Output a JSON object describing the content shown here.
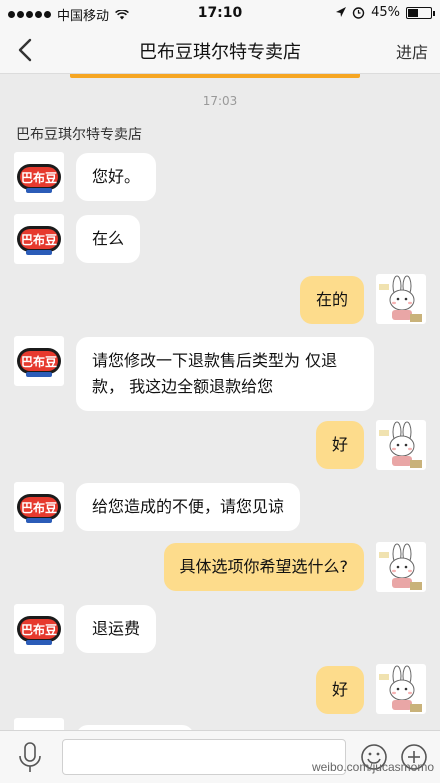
{
  "status_bar": {
    "carrier": "中国移动",
    "time": "17:10",
    "battery": "45%",
    "battery_level": 0.45
  },
  "nav": {
    "title": "巴布豆琪尔特专卖店",
    "enter_label": "进店",
    "back_icon": "chevron-left-icon"
  },
  "chat": {
    "timestamp": "17:03",
    "shop_name": "巴布豆琪尔特专卖店",
    "messages": [
      {
        "from": "shop",
        "text": "您好。"
      },
      {
        "from": "shop",
        "text": "在么"
      },
      {
        "from": "user",
        "text": "在的"
      },
      {
        "from": "shop",
        "text": "请您修改一下退款售后类型为 仅退款， 我这边全额退款给您"
      },
      {
        "from": "user",
        "text": "好"
      },
      {
        "from": "shop",
        "text": "给您造成的不便，请您见谅"
      },
      {
        "from": "user",
        "text": "具体选项你希望选什么?"
      },
      {
        "from": "shop",
        "text": "退运费"
      },
      {
        "from": "user",
        "text": "好"
      }
    ]
  },
  "input_bar": {
    "text": "",
    "mic_icon": "microphone-icon",
    "emoji_icon": "emoji-icon",
    "plus_icon": "plus-icon"
  },
  "shop_logo_text": "巴布豆",
  "watermark": "weibo.com/jucasmomo",
  "colors": {
    "user_bubble": "#fddc8c",
    "shop_bubble": "#ffffff",
    "accent": "#f6a623",
    "background": "#ebebeb"
  }
}
